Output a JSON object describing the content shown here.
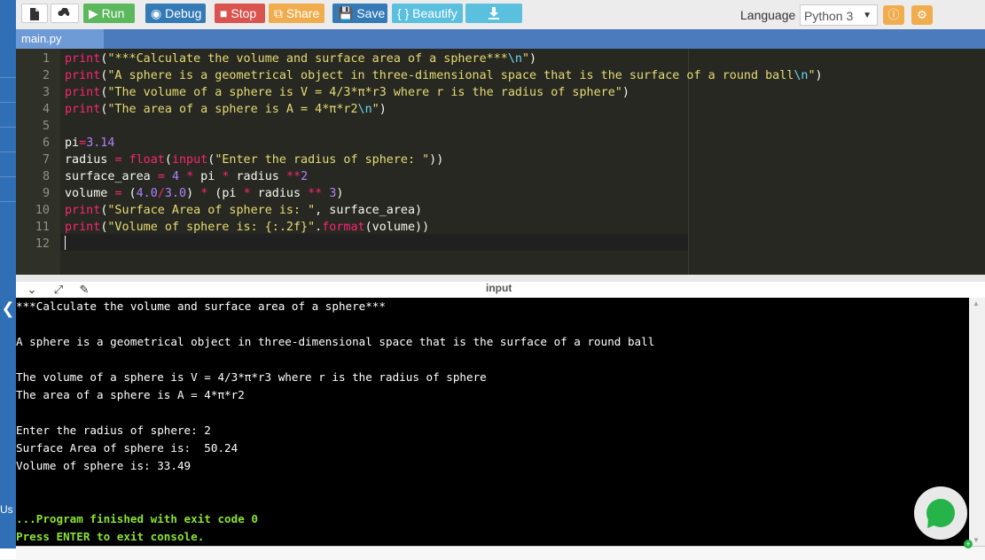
{
  "toolbar": {
    "run_label": "Run",
    "debug_label": "Debug",
    "stop_label": "Stop",
    "share_label": "Share",
    "save_label": "Save",
    "beautify_label": "{ } Beautify",
    "language_label": "Language",
    "language_value": "Python 3",
    "icons": [
      "new-file-icon",
      "upload-icon",
      "play-icon",
      "debug-icon",
      "stop-icon",
      "share-icon",
      "save-icon",
      "download-icon",
      "info-icon",
      "gear-icon"
    ]
  },
  "editor": {
    "file_tab": "main.py",
    "lines": [
      {
        "n": "1",
        "segs": [
          [
            "fn",
            "print"
          ],
          [
            "p",
            "("
          ],
          [
            "str",
            "\"***Calculate the volume and surface area of a sphere***"
          ],
          [
            "esc",
            "\\n"
          ],
          [
            "str",
            "\""
          ],
          [
            "p",
            ")"
          ]
        ]
      },
      {
        "n": "2",
        "segs": [
          [
            "fn",
            "print"
          ],
          [
            "p",
            "("
          ],
          [
            "str",
            "\"A sphere is a geometrical object in three-dimensional space that is the surface of a round ball"
          ],
          [
            "esc",
            "\\n"
          ],
          [
            "str",
            "\""
          ],
          [
            "p",
            ")"
          ]
        ]
      },
      {
        "n": "3",
        "segs": [
          [
            "fn",
            "print"
          ],
          [
            "p",
            "("
          ],
          [
            "str",
            "\"The volume of a sphere is V = 4/3*π*r3 where r is the radius of sphere\""
          ],
          [
            "p",
            ")"
          ]
        ]
      },
      {
        "n": "4",
        "segs": [
          [
            "fn",
            "print"
          ],
          [
            "p",
            "("
          ],
          [
            "str",
            "\"The area of a sphere is A = 4*π*r2"
          ],
          [
            "esc",
            "\\n"
          ],
          [
            "str",
            "\""
          ],
          [
            "p",
            ")"
          ]
        ]
      },
      {
        "n": "5",
        "segs": []
      },
      {
        "n": "6",
        "segs": [
          [
            "p",
            "pi"
          ],
          [
            "op",
            "="
          ],
          [
            "num",
            "3.14"
          ]
        ]
      },
      {
        "n": "7",
        "segs": [
          [
            "p",
            "radius "
          ],
          [
            "op",
            "="
          ],
          [
            "p",
            " "
          ],
          [
            "fn",
            "float"
          ],
          [
            "p",
            "("
          ],
          [
            "fn",
            "input"
          ],
          [
            "p",
            "("
          ],
          [
            "str",
            "\"Enter the radius of sphere: \""
          ],
          [
            "p",
            "))"
          ]
        ]
      },
      {
        "n": "8",
        "segs": [
          [
            "p",
            "surface_area "
          ],
          [
            "op",
            "="
          ],
          [
            "p",
            " "
          ],
          [
            "num",
            "4"
          ],
          [
            "p",
            " "
          ],
          [
            "op",
            "*"
          ],
          [
            "p",
            " pi "
          ],
          [
            "op",
            "*"
          ],
          [
            "p",
            " radius "
          ],
          [
            "op",
            "**"
          ],
          [
            "num",
            "2"
          ]
        ]
      },
      {
        "n": "9",
        "segs": [
          [
            "p",
            "volume "
          ],
          [
            "op",
            "="
          ],
          [
            "p",
            " ("
          ],
          [
            "num",
            "4.0"
          ],
          [
            "op",
            "/"
          ],
          [
            "num",
            "3.0"
          ],
          [
            "p",
            ") "
          ],
          [
            "op",
            "*"
          ],
          [
            "p",
            " (pi "
          ],
          [
            "op",
            "*"
          ],
          [
            "p",
            " radius "
          ],
          [
            "op",
            "**"
          ],
          [
            "p",
            " "
          ],
          [
            "num",
            "3"
          ],
          [
            "p",
            ")"
          ]
        ]
      },
      {
        "n": "10",
        "segs": [
          [
            "fn",
            "print"
          ],
          [
            "p",
            "("
          ],
          [
            "str",
            "\"Surface Area of sphere is: \""
          ],
          [
            "p",
            ", surface_area)"
          ]
        ]
      },
      {
        "n": "11",
        "segs": [
          [
            "fn",
            "print"
          ],
          [
            "p",
            "("
          ],
          [
            "str",
            "\"Volume of sphere is: {:.2f}\""
          ],
          [
            "p",
            "."
          ],
          [
            "fn",
            "format"
          ],
          [
            "p",
            "(volume))"
          ]
        ]
      },
      {
        "n": "12",
        "segs": []
      }
    ]
  },
  "output": {
    "title": "input",
    "lines": [
      "***Calculate the volume and surface area of a sphere***",
      "",
      "A sphere is a geometrical object in three-dimensional space that is the surface of a round ball",
      "",
      "The volume of a sphere is V = 4/3*π*r3 where r is the radius of sphere",
      "The area of a sphere is A = 4*π*r2",
      "",
      "Enter the radius of sphere: 2",
      "Surface Area of sphere is:  50.24",
      "Volume of sphere is: 33.49",
      "",
      "",
      "...Program finished with exit code 0",
      "Press ENTER to exit console."
    ],
    "highlight_from": 12
  },
  "sidebar": {
    "partial_text": "Us"
  },
  "colors": {
    "run": "#5cb85c",
    "debug": "#337ab7",
    "stop": "#d9534f",
    "share": "#f0ad4e",
    "save": "#337ab7",
    "beautify": "#5bc0de",
    "editor_bg": "#272822",
    "console_text_green": "#8ae234"
  }
}
